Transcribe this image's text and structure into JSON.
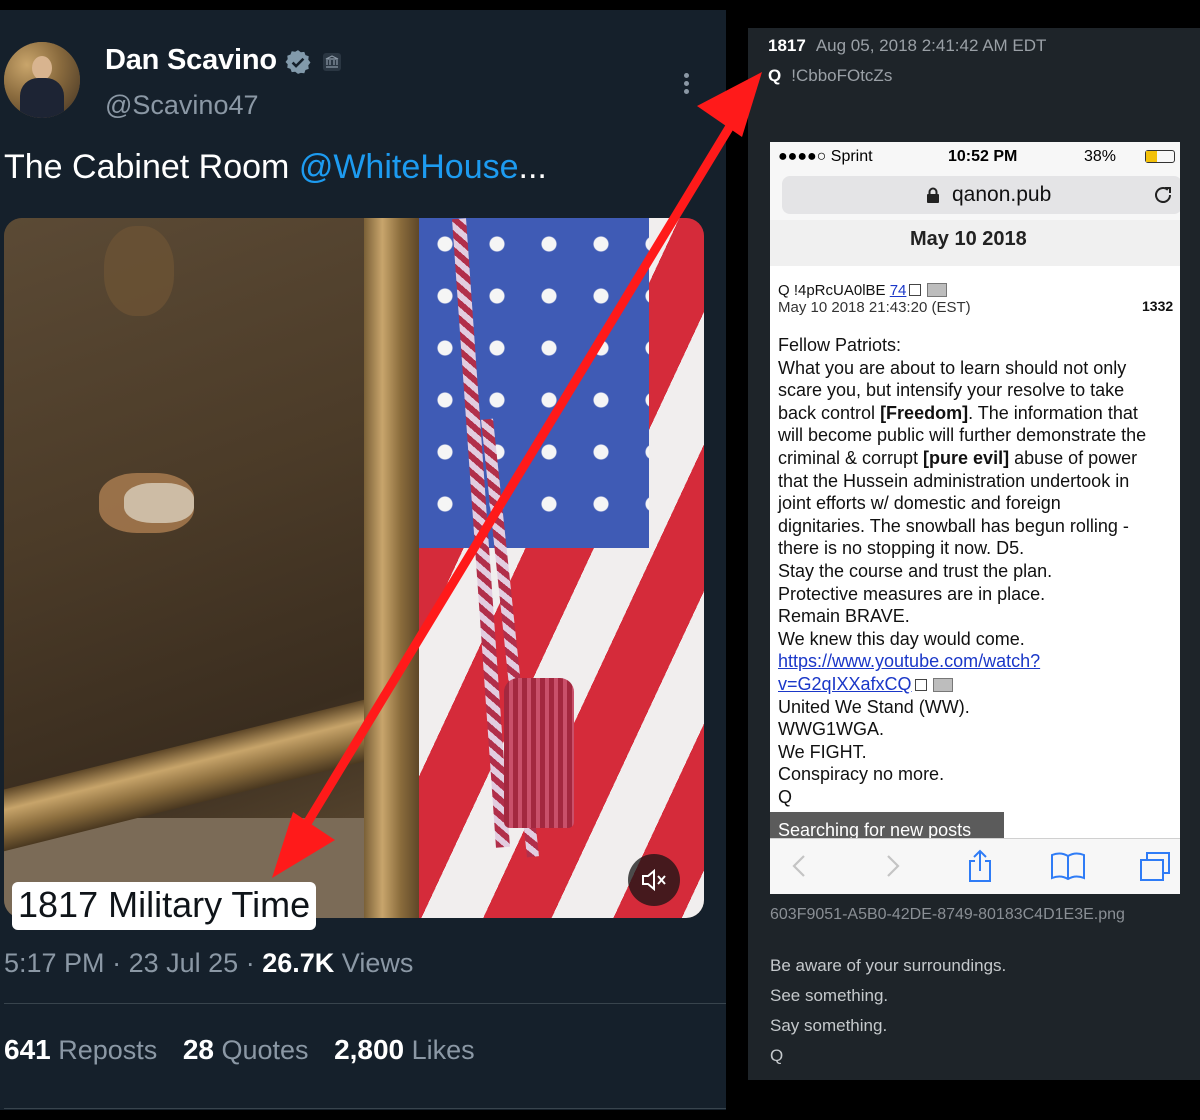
{
  "tweet": {
    "display_name": "Dan Scavino",
    "handle": "@Scavino47",
    "text_main": "The Cabinet Room ",
    "text_mention": "@WhiteHouse",
    "text_ellipsis": "...",
    "media_caption": "1817 Military Time",
    "time": "5:17 PM",
    "sep": "·",
    "date": "23 Jul 25",
    "views_count": "26.7K",
    "views_label": "Views",
    "reposts_count": "641",
    "reposts_label": "Reposts",
    "quotes_count": "28",
    "quotes_label": "Quotes",
    "likes_count": "2,800",
    "likes_label": "Likes",
    "icons": [
      "verified-badge-icon",
      "government-label-icon",
      "more-options-icon",
      "mute-icon"
    ],
    "colors": {
      "background": "#15202b",
      "mention": "#1d9bf0",
      "verified": "#829aab"
    }
  },
  "q_post": {
    "number": "1817",
    "timestamp": "Aug 05, 2018 2:41:42 AM EDT",
    "author": "Q",
    "tripcode": "!CbboFOtcZs",
    "filename": "603F9051-A5B0-42DE-8749-80183C4D1E3E.png",
    "message": [
      "Be aware of your surroundings.",
      "See something.",
      "Say something.",
      "Q"
    ]
  },
  "phone": {
    "carrier": "●●●●○ Sprint",
    "time": "10:52 PM",
    "battery": "38%",
    "battery_level": 0.38,
    "url": "qanon.pub",
    "date_strip": "May 10 2018",
    "post_author": "Q !4pRcUA0lBE",
    "post_ref": "74",
    "post_date": "May 10 2018 21:43:20 (EST)",
    "post_number": "1332",
    "lines": [
      "Fellow Patriots:",
      "What you are about to learn should not only",
      "scare you, but intensify your resolve to take",
      "back control ",
      "[Freedom]",
      ". The information that",
      "will become public will further demonstrate the",
      "criminal & corrupt ",
      "[pure evil]",
      " abuse of power",
      "that the Hussein administration undertook in",
      "joint efforts w/ domestic and foreign",
      "dignitaries. The snowball has begun rolling -",
      "there is no stopping it now. D5.",
      "Stay the course and trust the plan.",
      "Protective measures are in place.",
      "Remain BRAVE.",
      "We knew this day would come.",
      "https://www.youtube.com/watch?",
      "v=G2qIXXafxCQ",
      "United We Stand (WW).",
      "WWG1WGA.",
      "We FIGHT.",
      "Conspiracy no more.",
      "Q"
    ],
    "searching": "Searching for new posts",
    "toolbar_icons": [
      "back-icon",
      "forward-icon",
      "share-icon",
      "bookmarks-icon",
      "tabs-icon"
    ]
  },
  "annotation": {
    "arrow_color": "#ff1a1a"
  }
}
